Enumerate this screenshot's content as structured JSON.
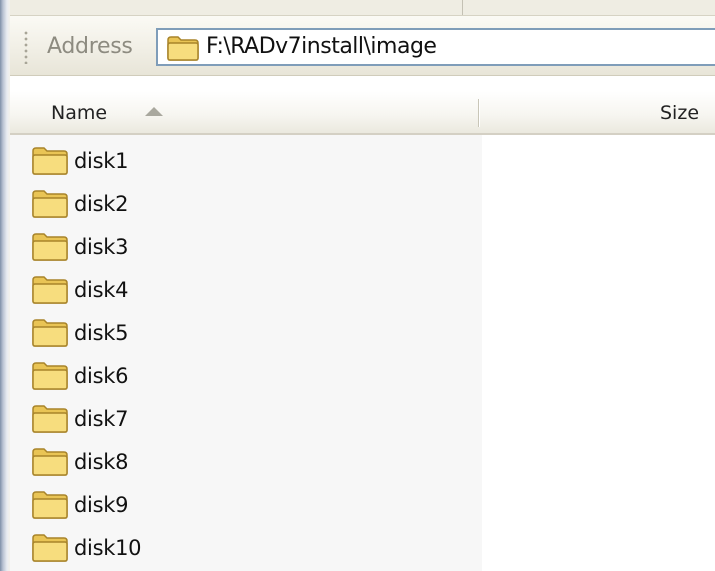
{
  "address_bar": {
    "label": "Address",
    "path": "F:\\RADv7install\\image",
    "icon": "folder-icon"
  },
  "list_view": {
    "columns": [
      {
        "label": "Name",
        "sorted": "ascending"
      },
      {
        "label": "Size"
      }
    ],
    "items": [
      {
        "name": "disk1",
        "type": "folder"
      },
      {
        "name": "disk2",
        "type": "folder"
      },
      {
        "name": "disk3",
        "type": "folder"
      },
      {
        "name": "disk4",
        "type": "folder"
      },
      {
        "name": "disk5",
        "type": "folder"
      },
      {
        "name": "disk6",
        "type": "folder"
      },
      {
        "name": "disk7",
        "type": "folder"
      },
      {
        "name": "disk8",
        "type": "folder"
      },
      {
        "name": "disk9",
        "type": "folder"
      },
      {
        "name": "disk10",
        "type": "folder"
      }
    ]
  },
  "colors": {
    "folder_fill": "#f2d36b",
    "folder_outline": "#b08a2a",
    "field_border": "#7f9db9"
  }
}
